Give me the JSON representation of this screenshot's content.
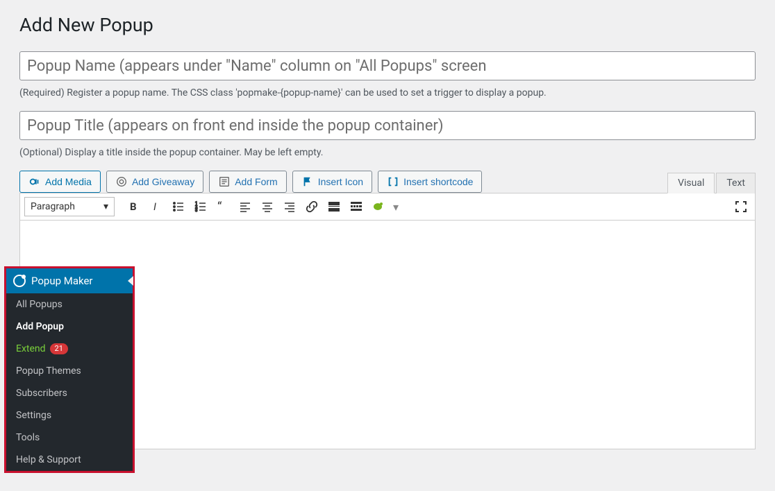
{
  "page": {
    "title": "Add New Popup"
  },
  "inputs": {
    "name_placeholder": "Popup Name (appears under \"Name\" column on \"All Popups\" screen",
    "name_helper": "(Required) Register a popup name. The CSS class 'popmake-{popup-name}' can be used to set a trigger to display a popup.",
    "title_placeholder": "Popup Title (appears on front end inside the popup container)",
    "title_helper": "(Optional) Display a title inside the popup container. May be left empty."
  },
  "media_buttons": {
    "add_media": "Add Media",
    "add_giveaway": "Add Giveaway",
    "add_form": "Add Form",
    "insert_icon": "Insert Icon",
    "insert_shortcode": "Insert shortcode"
  },
  "editor_tabs": {
    "visual": "Visual",
    "text": "Text"
  },
  "format_select": {
    "value": "Paragraph"
  },
  "sidebar": {
    "header": "Popup Maker",
    "items": [
      {
        "label": "All Popups",
        "state": ""
      },
      {
        "label": "Add Popup",
        "state": "active"
      },
      {
        "label": "Extend",
        "state": "extend",
        "badge": "21"
      },
      {
        "label": "Popup Themes",
        "state": ""
      },
      {
        "label": "Subscribers",
        "state": ""
      },
      {
        "label": "Settings",
        "state": ""
      },
      {
        "label": "Tools",
        "state": ""
      },
      {
        "label": "Help & Support",
        "state": ""
      }
    ]
  }
}
